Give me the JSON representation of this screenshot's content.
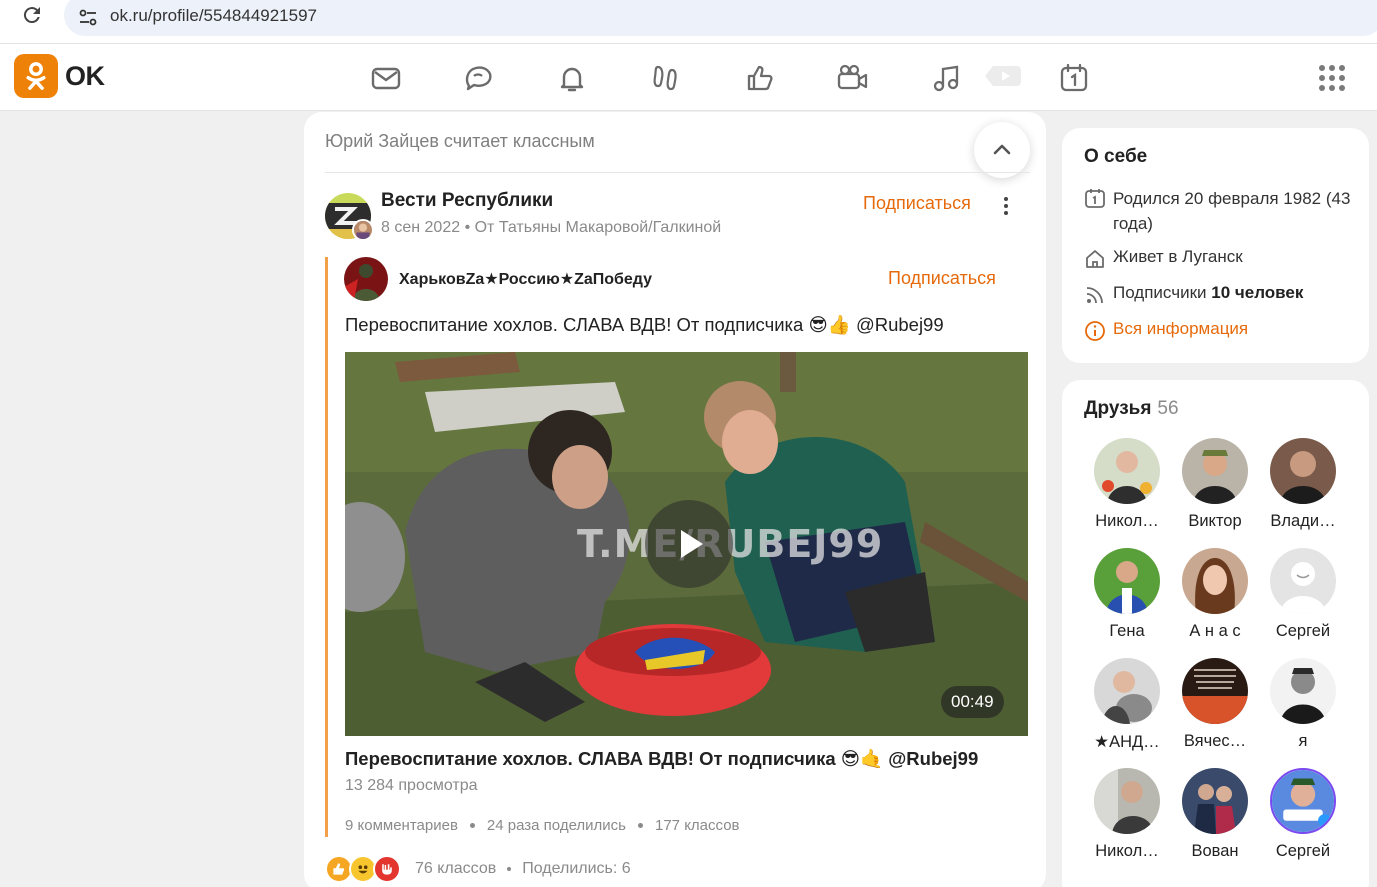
{
  "browser": {
    "url": "ok.ru/profile/554844921597"
  },
  "brand": {
    "logo_text": "OK",
    "accent": "#ee8208",
    "link_color": "#e66a0b"
  },
  "nav": {
    "icons": [
      "messages-icon",
      "discussions-icon",
      "notifications-icon",
      "guests-icon",
      "likes-icon",
      "video-icon",
      "music-icon",
      "video-showcase-icon",
      "events-icon",
      "apps-icon"
    ]
  },
  "feed": {
    "liked_line": "Юрий Зайцев считает классным",
    "group_name": "Вести Республики",
    "post_meta": "8 сен 2022 • От Татьяны Макаровой/Галкиной",
    "subscribe_label": "Подписаться",
    "repost": {
      "author": "ХарьковZa★Россию★ZaПобеду",
      "subscribe_label": "Подписаться",
      "text": "Перевоспитание хохлов. СЛАВА ВДВ! От подписчика 😎👍 @Rubej99",
      "video": {
        "watermark": "T.ME/RUBEJ99",
        "duration": "00:49",
        "title": "Перевоспитание хохлов. СЛАВА ВДВ! От подписчика 😎🤙 @Rubej99",
        "views": "13 284 просмотра"
      },
      "stats": {
        "comments": "9 комментариев",
        "shares": "24 раза поделились",
        "likes": "177 классов"
      }
    },
    "reactions": {
      "likes": "76 классов",
      "shared": "Поделились: 6"
    }
  },
  "about": {
    "title": "О себе",
    "born": "Родился 20 февраля 1982 (43 года)",
    "lives": "Живет в Луганск",
    "followers_prefix": "Подписчики",
    "followers_count": "10 человек",
    "all_info": "Вся информация"
  },
  "friends": {
    "title": "Друзья",
    "count": "56",
    "items": [
      {
        "name": "Никол…"
      },
      {
        "name": "Виктор"
      },
      {
        "name": "Влади…"
      },
      {
        "name": "Гена"
      },
      {
        "name": "А н а с"
      },
      {
        "name": "Сергей"
      },
      {
        "name": "★АНД…"
      },
      {
        "name": "Вячес…"
      },
      {
        "name": "я"
      },
      {
        "name": "Никол…"
      },
      {
        "name": "Вован"
      },
      {
        "name": "Сергей"
      }
    ]
  }
}
